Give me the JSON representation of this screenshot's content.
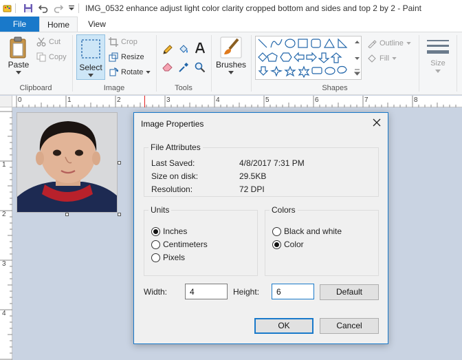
{
  "window": {
    "title": "IMG_0532 enhance adjust light color clarity cropped bottom and sides and top 2 by 2 - Paint"
  },
  "tabs": {
    "file": "File",
    "home": "Home",
    "view": "View"
  },
  "ribbon": {
    "clipboard": {
      "label": "Clipboard",
      "paste": "Paste",
      "cut": "Cut",
      "copy": "Copy"
    },
    "image": {
      "label": "Image",
      "select": "Select",
      "crop": "Crop",
      "resize": "Resize",
      "rotate": "Rotate"
    },
    "tools": {
      "label": "Tools"
    },
    "brushes": {
      "label": "Brushes"
    },
    "shapes": {
      "label": "Shapes",
      "outline": "Outline",
      "fill": "Fill"
    },
    "size": {
      "label": "Size"
    }
  },
  "ruler": {
    "top": [
      "0",
      "1",
      "2",
      "3",
      "4",
      "5",
      "6",
      "7",
      "8"
    ],
    "left": [
      "1",
      "2",
      "3",
      "4"
    ]
  },
  "dialog": {
    "title": "Image Properties",
    "file_attributes": {
      "title": "File Attributes",
      "last_saved_label": "Last Saved:",
      "last_saved_value": "4/8/2017 7:31 PM",
      "size_label": "Size on disk:",
      "size_value": "29.5KB",
      "resolution_label": "Resolution:",
      "resolution_value": "72 DPI"
    },
    "units": {
      "title": "Units",
      "inches": "Inches",
      "centimeters": "Centimeters",
      "pixels": "Pixels",
      "selected": "inches"
    },
    "colors": {
      "title": "Colors",
      "bw": "Black and white",
      "color": "Color",
      "selected": "color"
    },
    "width_label": "Width:",
    "width_value": "4",
    "height_label": "Height:",
    "height_value": "6",
    "default_btn": "Default",
    "ok_btn": "OK",
    "cancel_btn": "Cancel"
  },
  "colors": {
    "accent": "#1979ca",
    "canvas_bg": "#c9d3e2",
    "ribbon_bg": "#f5f6f7"
  }
}
